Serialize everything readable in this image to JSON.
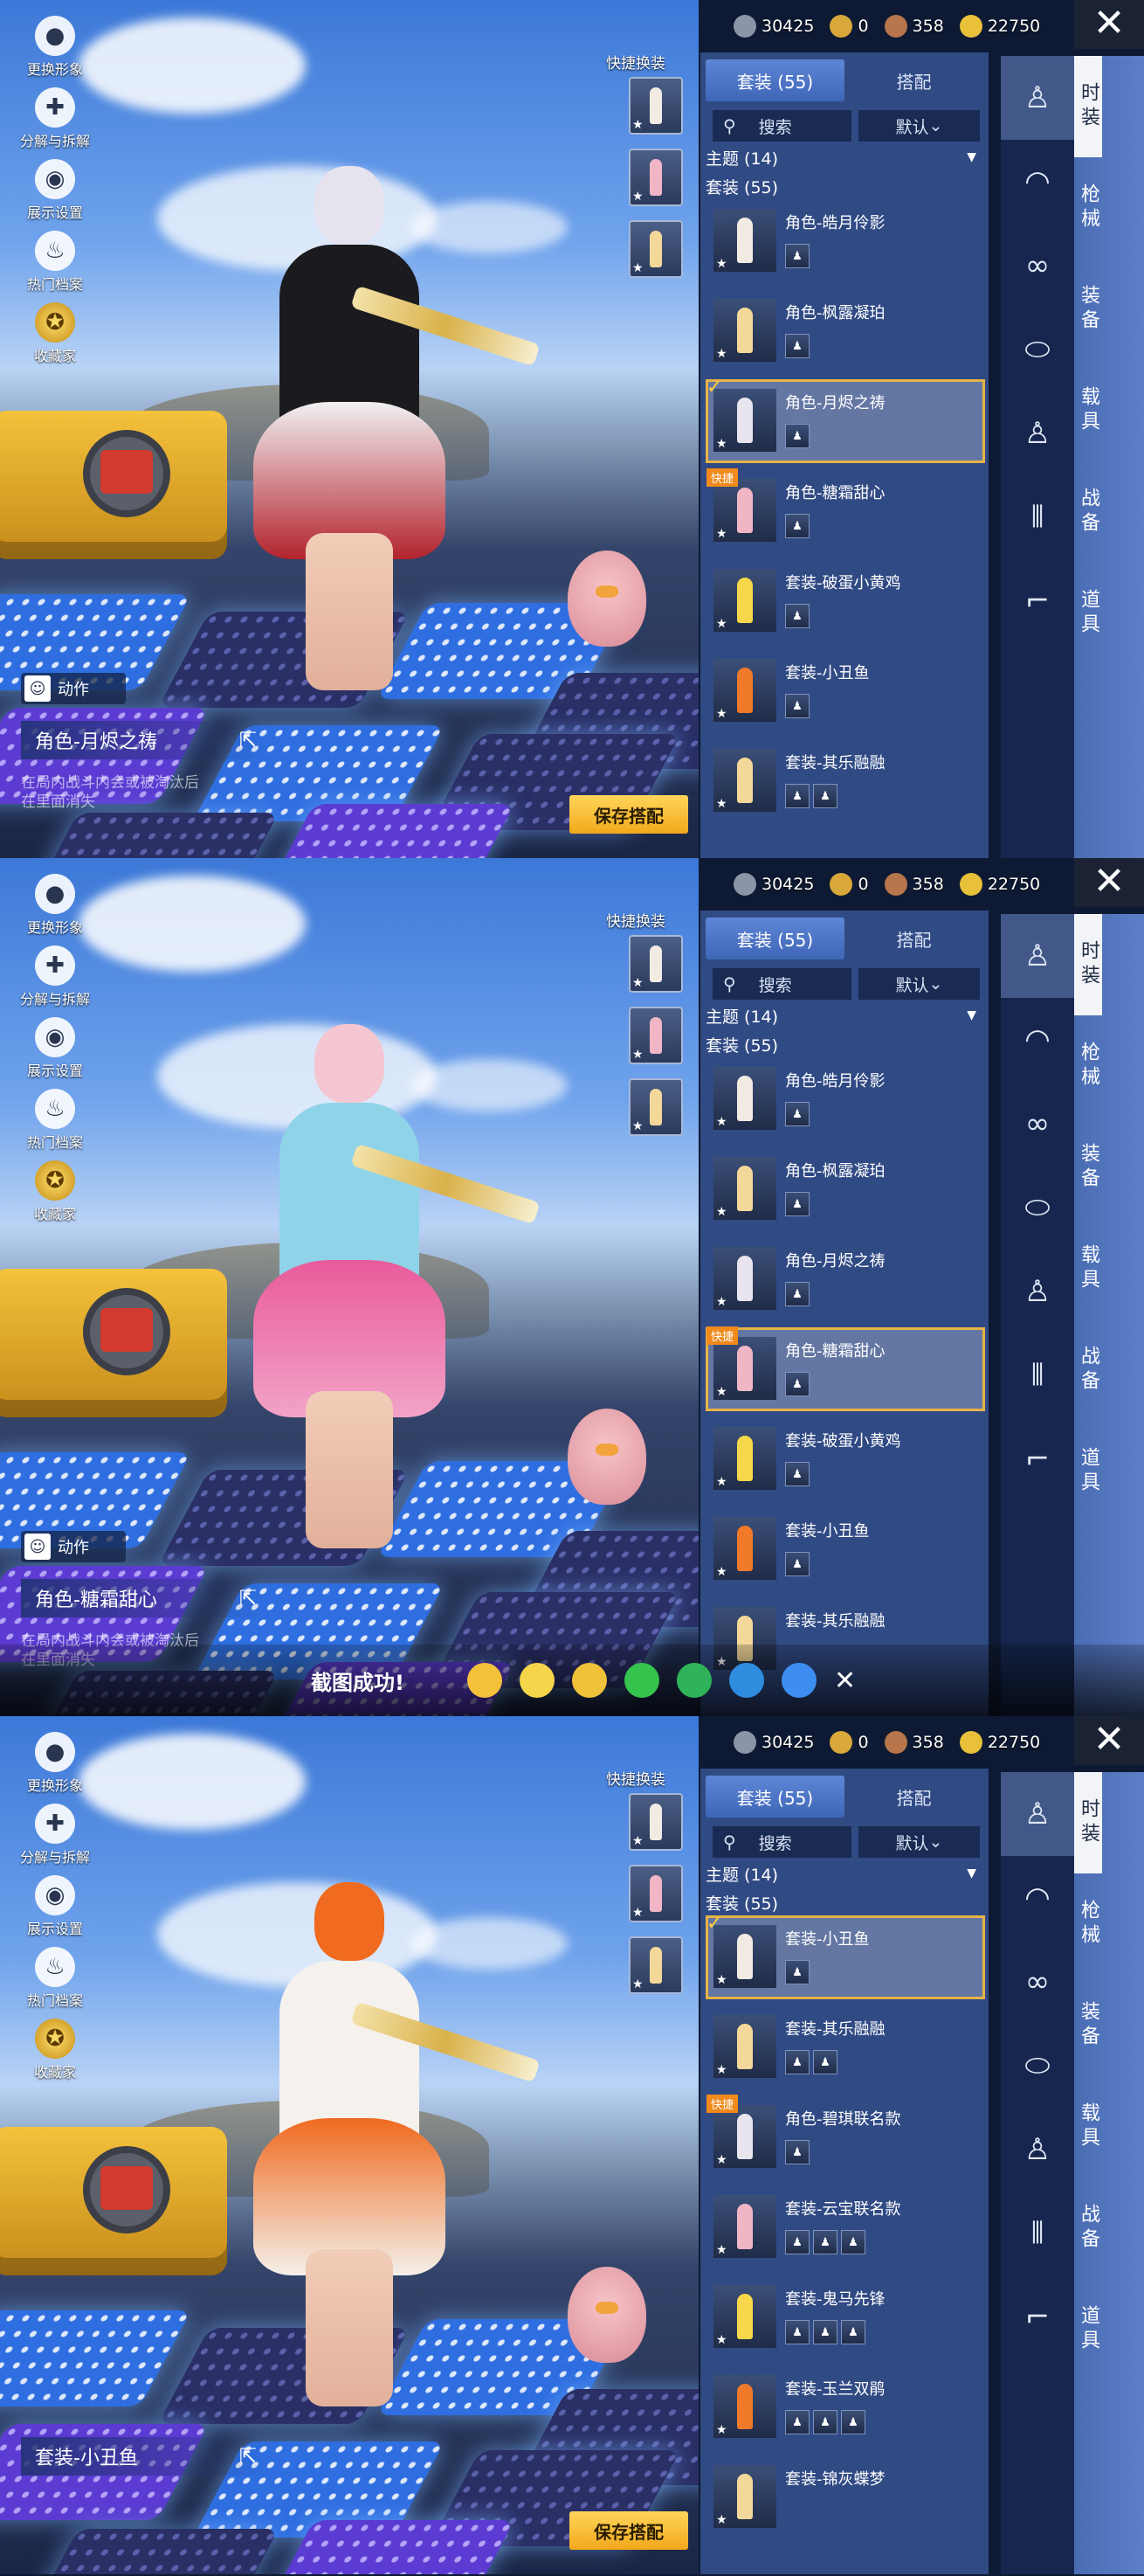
{
  "currency": [
    {
      "icon": "coin-icon",
      "value": "30425",
      "color": "#8c94a8"
    },
    {
      "icon": "uc-icon",
      "value": "0",
      "color": "#d8a93a"
    },
    {
      "icon": "bronze-icon",
      "value": "358",
      "color": "#b7764b"
    },
    {
      "icon": "gold-icon",
      "value": "22750",
      "color": "#e8c03a"
    }
  ],
  "close_label": "✕",
  "left_icons": [
    "更换形象",
    "分解与拆解",
    "展示设置",
    "热门档案",
    "收藏家"
  ],
  "quick_swap_label": "快捷换装",
  "action_label": "动作",
  "tabs": [
    "套装 (55)",
    "搭配"
  ],
  "search_label": "搜索",
  "sort_label": "默认",
  "group_theme": "主题 (14)",
  "group_suits": "套装 (55)",
  "side_categories": [
    "时装",
    "枪械",
    "装备",
    "载具",
    "战备",
    "道具"
  ],
  "side_icons": [
    "outfit-icon",
    "cap-icon",
    "glasses-icon",
    "mask-icon",
    "outfit-icon",
    "pants-icon",
    "shoes-icon"
  ],
  "desc_text": "在局内战斗内会或被淘汰后\n在里面消失",
  "save_label": "保存搭配",
  "share": {
    "ok": "截图成功!",
    "close": "✕"
  },
  "panels": [
    {
      "outfit_name": "角色-月烬之祷",
      "char_colors": {
        "hair": "#e6e3ee",
        "top": "#1b1b1f",
        "skirt": "#f1f0f2",
        "hem": "#b3232d"
      },
      "items": [
        {
          "name": "角色-皓月伶影",
          "subs": 1,
          "selected": false,
          "badge": ""
        },
        {
          "name": "角色-枫露凝珀",
          "subs": 1,
          "selected": false,
          "badge": ""
        },
        {
          "name": "角色-月烬之祷",
          "subs": 1,
          "selected": true,
          "badge": ""
        },
        {
          "name": "角色-糖霜甜心",
          "subs": 1,
          "selected": false,
          "badge": "快捷"
        },
        {
          "name": "套装-破蛋小黄鸡",
          "subs": 1,
          "selected": false,
          "badge": ""
        },
        {
          "name": "套装-小丑鱼",
          "subs": 1,
          "selected": false,
          "badge": ""
        },
        {
          "name": "套装-其乐融融",
          "subs": 2,
          "selected": false,
          "badge": ""
        }
      ]
    },
    {
      "outfit_name": "角色-糖霜甜心",
      "char_colors": {
        "hair": "#f4c6d2",
        "top": "#8fd3e8",
        "skirt": "#e95b9b",
        "hem": "#f2a3c7"
      },
      "items": [
        {
          "name": "角色-皓月伶影",
          "subs": 1,
          "selected": false,
          "badge": ""
        },
        {
          "name": "角色-枫露凝珀",
          "subs": 1,
          "selected": false,
          "badge": ""
        },
        {
          "name": "角色-月烬之祷",
          "subs": 1,
          "selected": false,
          "badge": ""
        },
        {
          "name": "角色-糖霜甜心",
          "subs": 1,
          "selected": true,
          "badge": "快捷"
        },
        {
          "name": "套装-破蛋小黄鸡",
          "subs": 1,
          "selected": false,
          "badge": ""
        },
        {
          "name": "套装-小丑鱼",
          "subs": 1,
          "selected": false,
          "badge": ""
        },
        {
          "name": "套装-其乐融融",
          "subs": 0,
          "selected": false,
          "badge": ""
        }
      ]
    },
    {
      "outfit_name": "套装-小丑鱼",
      "char_colors": {
        "hair": "#f06b1f",
        "top": "#f5f1ec",
        "skirt": "#ef6a1f",
        "hem": "#f4f0ea"
      },
      "items": [
        {
          "name": "套装-小丑鱼",
          "subs": 1,
          "selected": true,
          "badge": ""
        },
        {
          "name": "套装-其乐融融",
          "subs": 2,
          "selected": false,
          "badge": ""
        },
        {
          "name": "角色-碧琪联名款",
          "subs": 1,
          "selected": false,
          "badge": "快捷"
        },
        {
          "name": "套装-云宝联名款",
          "subs": 3,
          "selected": false,
          "badge": ""
        },
        {
          "name": "套装-鬼马先锋",
          "subs": 3,
          "selected": false,
          "badge": ""
        },
        {
          "name": "套装-玉兰双鹃",
          "subs": 3,
          "selected": false,
          "badge": ""
        },
        {
          "name": "套装-锦灰蝶梦",
          "subs": 0,
          "selected": false,
          "badge": ""
        }
      ]
    }
  ]
}
